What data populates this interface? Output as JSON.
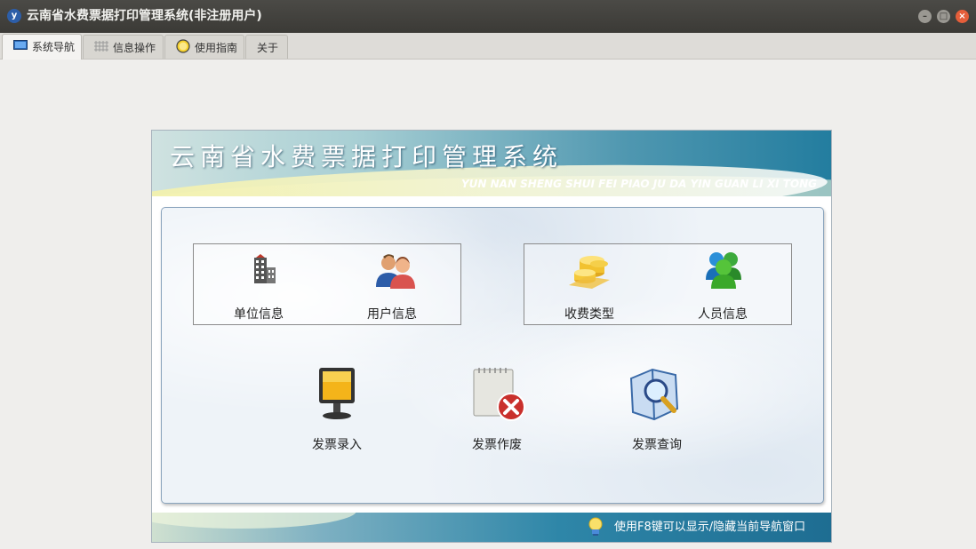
{
  "window": {
    "title": "云南省水费票据打印管理系统(非注册用户)",
    "icon": "app-logo-icon"
  },
  "tabs": [
    {
      "label": "系统导航",
      "icon": "monitor-icon",
      "active": true
    },
    {
      "label": "信息操作",
      "icon": "grid-icon",
      "active": false
    },
    {
      "label": "使用指南",
      "icon": "smiley-icon",
      "active": false
    },
    {
      "label": "关于",
      "icon": "",
      "active": false
    }
  ],
  "banner": {
    "title": "云南省水费票据打印管理系统",
    "subtitle": "YUN NAN SHENG SHUI FEI PIAO JU DA YIN GUAN LI XI TONG"
  },
  "nav": {
    "unit_info": "单位信息",
    "user_info": "用户信息",
    "fee_type": "收费类型",
    "staff_info": "人员信息",
    "invoice_entry": "发票录入",
    "invoice_void": "发票作废",
    "invoice_query": "发票查询"
  },
  "footer": {
    "hint": "使用F8键可以显示/隐藏当前导航窗口"
  },
  "colors": {
    "titlebar": "#3b3a36",
    "close": "#e55e3a",
    "banner_accent": "#237d9f"
  }
}
